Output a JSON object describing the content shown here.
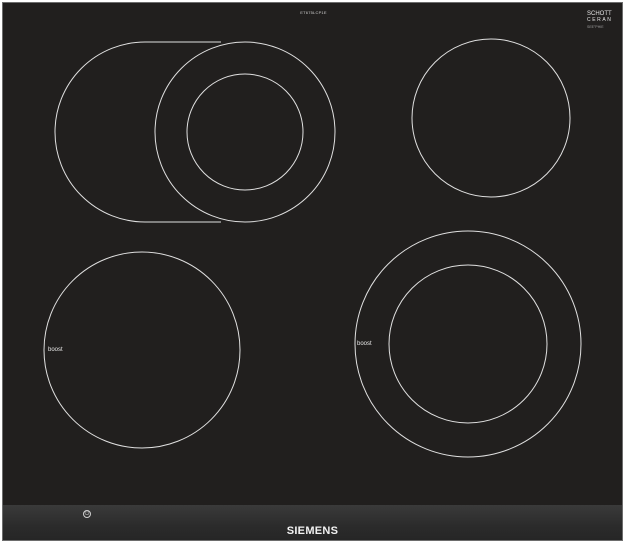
{
  "product": {
    "model_code": "ET675LCP1E",
    "glass_brand_line1": "SCHOTT",
    "glass_brand_line2": "CERAN",
    "glass_brand_line3": "SEE°PHIE",
    "brand": "SIEMENS"
  },
  "zones": {
    "boost_label": "boost"
  },
  "controls": {
    "power_symbol": "⏻"
  },
  "colors": {
    "glass": "#211f1e",
    "zone_outline": "#e0e0e0",
    "frame": "#6d6d6d",
    "text": "#e8e8e8"
  }
}
